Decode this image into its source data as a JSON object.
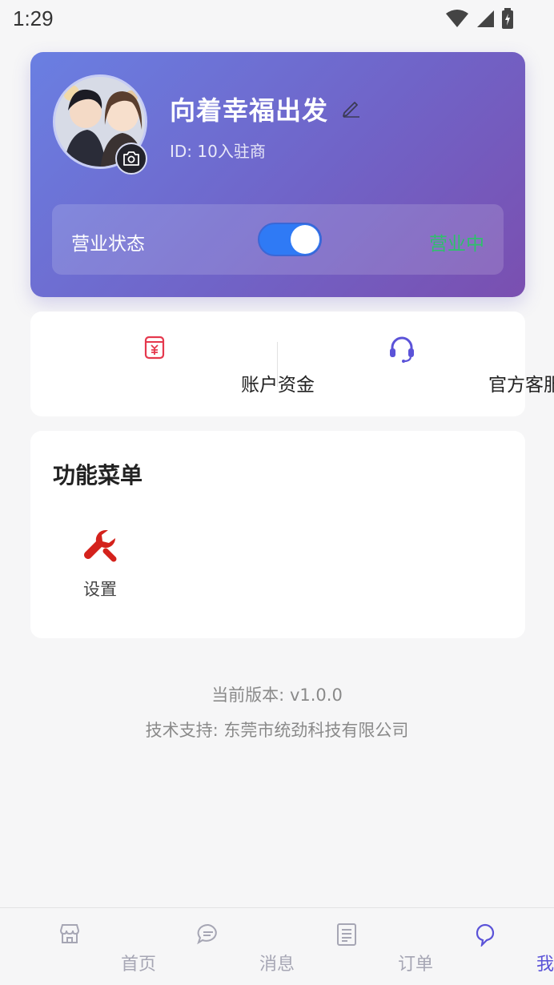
{
  "status_bar": {
    "time": "1:29"
  },
  "profile": {
    "name": "向着幸福出发",
    "id_text": "ID: 10入驻商",
    "status_label": "营业状态",
    "status_value": "营业中",
    "toggle_on": true
  },
  "quick_actions": [
    {
      "label": "账户资金",
      "icon": "wallet-yuan-icon",
      "color": "#e5384d"
    },
    {
      "label": "官方客服",
      "icon": "headset-icon",
      "color": "#5b53d8"
    }
  ],
  "menu": {
    "title": "功能菜单",
    "items": [
      {
        "label": "设置",
        "icon": "wrench-icon",
        "color": "#d4221c"
      }
    ]
  },
  "footer": {
    "version": "当前版本: v1.0.0",
    "support": "技术支持: 东莞市统劲科技有限公司"
  },
  "tabs": [
    {
      "label": "首页",
      "icon": "store-icon",
      "active": false
    },
    {
      "label": "消息",
      "icon": "message-icon",
      "active": false
    },
    {
      "label": "订单",
      "icon": "order-icon",
      "active": false
    },
    {
      "label": "我的",
      "icon": "profile-icon",
      "active": true
    }
  ],
  "colors": {
    "accent": "#5b53d8",
    "status_green": "#2ec06b",
    "toggle_blue": "#2f7af5"
  }
}
